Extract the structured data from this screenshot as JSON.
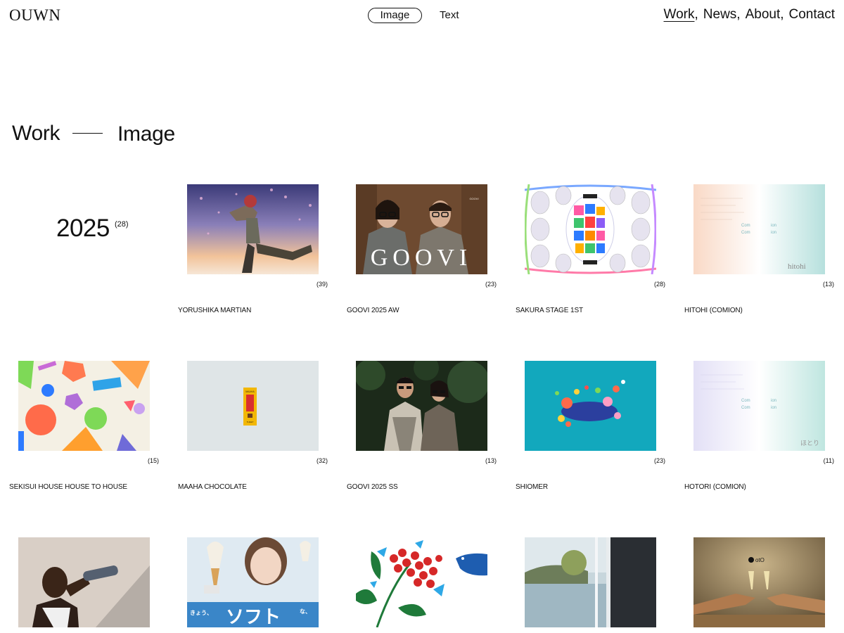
{
  "header": {
    "logo": "OUWN",
    "toggle": {
      "image": "Image",
      "text": "Text"
    },
    "nav": [
      {
        "label": "Work",
        "sep": ",",
        "active": true
      },
      {
        "label": "News",
        "sep": ","
      },
      {
        "label": "About",
        "sep": ","
      },
      {
        "label": "Contact",
        "sep": ""
      }
    ]
  },
  "heading": {
    "left": "Work",
    "right": "Image"
  },
  "year": {
    "label": "2025",
    "count": "(28)"
  },
  "thumb_text": {
    "goovi_logo": "GOOVI",
    "goovi_mark": "GOOVI",
    "hitohi_logo": "hitohi",
    "hotori_logo": "ほとり",
    "maaha_brand": "MAAHA",
    "maaha_sub": "THEET",
    "soft_main": "ソフト",
    "soft_left": "きょう、",
    "soft_right": "な、",
    "oto_logo": "otO",
    "com_label": "Com",
    "ion_label": "ion"
  },
  "works": [
    {
      "title": "YORUSHIKA MARTIAN",
      "count": "(39)",
      "icon": "anime-illustration"
    },
    {
      "title": "GOOVI 2025 AW",
      "count": "(23)",
      "icon": "eyewear-portrait-photo"
    },
    {
      "title": "SAKURA STAGE 1ST",
      "count": "(28)",
      "icon": "lantern-poster"
    },
    {
      "title": "HITOHI (COMION)",
      "count": "(13)",
      "icon": "gradient-stationery"
    },
    {
      "title": "SEKISUI HOUSE HOUSE TO HOUSE",
      "count": "(15)",
      "icon": "geometric-shapes"
    },
    {
      "title": "MAAHA CHOCOLATE",
      "count": "(32)",
      "icon": "chocolate-package"
    },
    {
      "title": "GOOVI 2025 SS",
      "count": "(13)",
      "icon": "couple-outdoor-photo"
    },
    {
      "title": "SHIOMER",
      "count": "(23)",
      "icon": "colorful-creature"
    },
    {
      "title": "HOTORI (COMION)",
      "count": "(11)",
      "icon": "gradient-stationery"
    },
    {
      "title": "",
      "count": "",
      "icon": "athlete-drinking-photo"
    },
    {
      "title": "",
      "count": "",
      "icon": "soft-serve-ad"
    },
    {
      "title": "",
      "count": "",
      "icon": "berry-bird-illustration"
    },
    {
      "title": "",
      "count": "",
      "icon": "window-lake-photo"
    },
    {
      "title": "",
      "count": "",
      "icon": "champagne-toast-photo"
    }
  ]
}
